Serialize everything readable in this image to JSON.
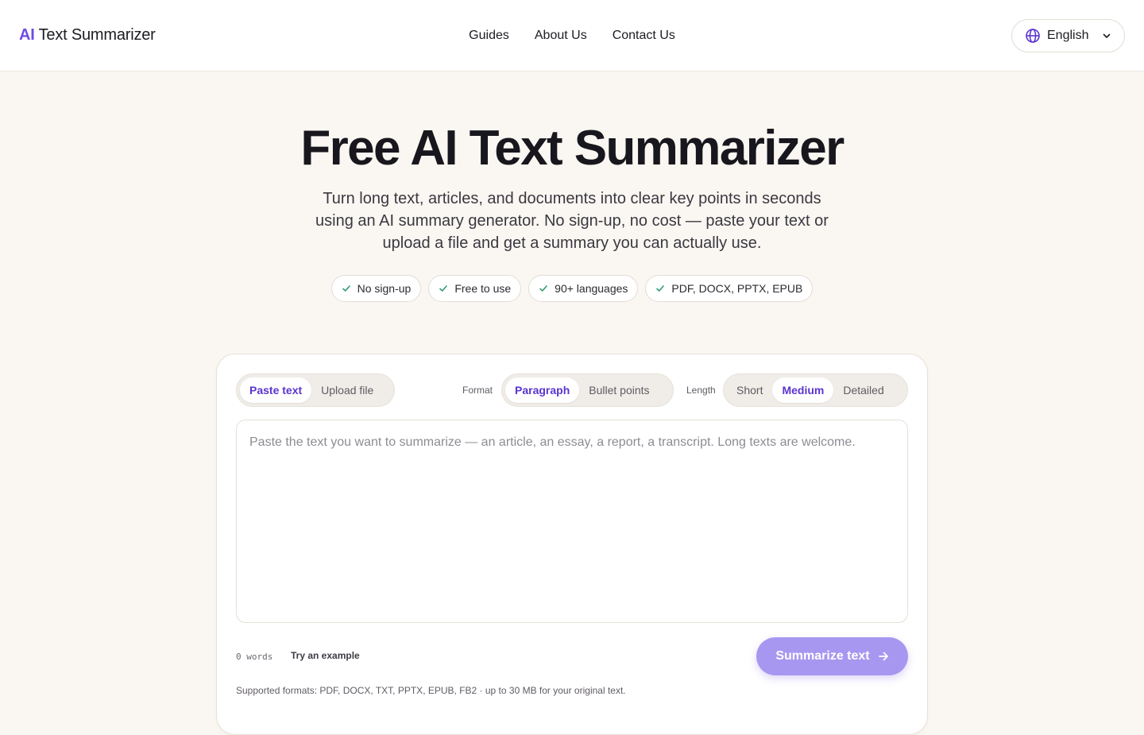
{
  "header": {
    "logo_ai": "AI",
    "logo_rest": " Text Summarizer",
    "nav": [
      "Guides",
      "About Us",
      "Contact Us"
    ],
    "language": "English"
  },
  "hero": {
    "title": "Free AI Text Summarizer",
    "subtitle": "Turn long text, articles, and documents into clear key points in seconds using an AI summary generator. No sign-up, no cost — paste your text or upload a file and get a summary you can actually use.",
    "badges": [
      "No sign-up",
      "Free to use",
      "90+ languages",
      "PDF, DOCX, PPTX, EPUB"
    ]
  },
  "tool": {
    "source_tabs": [
      "Paste text",
      "Upload file"
    ],
    "source_active": "Paste text",
    "format_label": "Format",
    "format_options": [
      "Paragraph",
      "Bullet points"
    ],
    "format_active": "Paragraph",
    "length_label": "Length",
    "length_options": [
      "Short",
      "Medium",
      "Detailed"
    ],
    "length_active": "Medium",
    "input_placeholder": "Paste the text you want to summarize — an article, an essay, a report, a transcript. Long texts are welcome.",
    "input_value": "",
    "word_count": "0 words",
    "example_link": "Try an example",
    "submit_label": "Summarize text",
    "supported_note": "Supported formats: PDF, DOCX, TXT, PPTX, EPUB, FB2 · up to 30 MB for your original text."
  },
  "colors": {
    "accent": "#6d4ce6",
    "accent_text": "#5b34cf",
    "submit_bg": "#a897f0",
    "check": "#2f9e6e",
    "page_bg": "#faf7f2"
  }
}
